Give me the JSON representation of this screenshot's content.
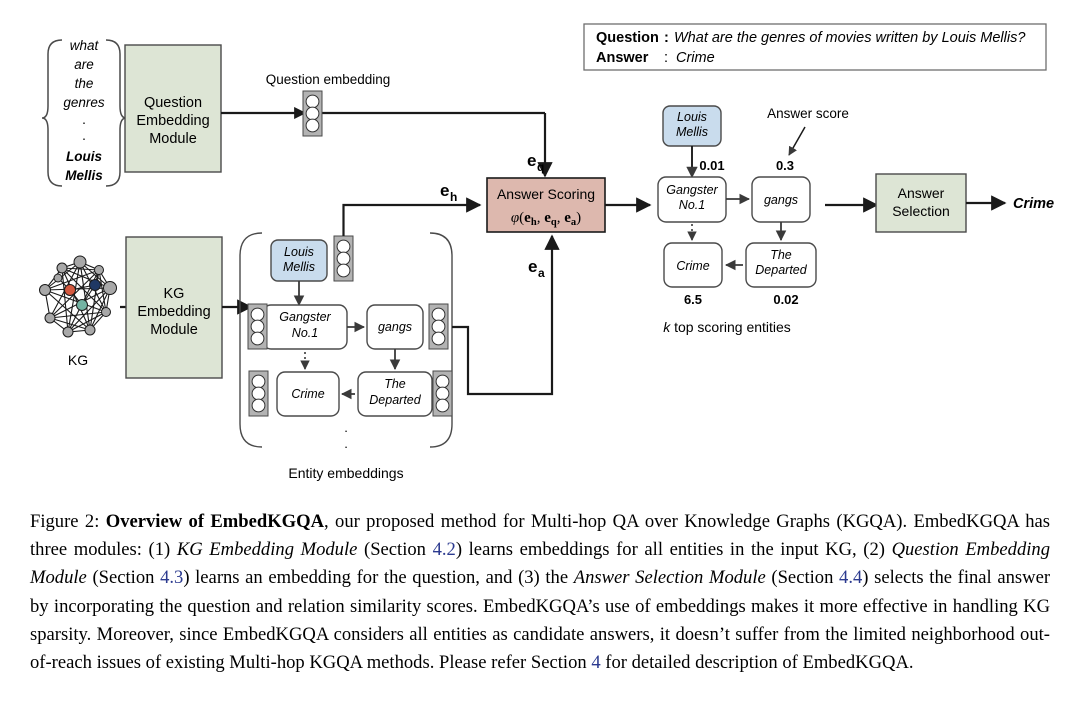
{
  "figure": {
    "qa_box": {
      "question_label": "Question",
      "question_sep": ":",
      "question_text": "What are the genres of movies written by Louis Mellis?",
      "answer_label": "Answer",
      "answer_sep": ":",
      "answer_text": "Crime"
    },
    "question_input": {
      "lines": [
        "what",
        "are",
        "the",
        "genres",
        ".",
        ".",
        "Louis",
        "Mellis"
      ],
      "bold_lines": [
        "Louis",
        "Mellis"
      ]
    },
    "modules": {
      "question_embedding_module": "Question\nEmbedding\nModule",
      "question_embedding_module_lines": [
        "Question",
        "Embedding",
        "Module"
      ],
      "kg_embedding_module_lines": [
        "KG",
        "Embedding",
        "Module"
      ],
      "answer_scoring_title": "Answer Scoring",
      "answer_scoring_formula": "φ(e_h, e_q, e_a)",
      "answer_selection_lines": [
        "Answer",
        "Selection"
      ]
    },
    "labels": {
      "question_embedding": "Question embedding",
      "kg": "KG",
      "entity_embeddings": "Entity embeddings",
      "answer_score": "Answer score",
      "k_top_scoring": "k top scoring entities",
      "e_h": "e_h",
      "e_q": "e_q",
      "e_a": "e_a",
      "final_answer": "Crime"
    },
    "kg_graph_nodes": {
      "highlight_red": "#d4593f",
      "highlight_teal": "#73b3a3",
      "highlight_navy": "#1f3864",
      "default_node": "#a8a8a8"
    },
    "entity_graph": {
      "head_entity": {
        "lines": [
          "Louis",
          "Mellis"
        ]
      },
      "entities": [
        {
          "id": "gangster",
          "lines": [
            "Gangster",
            "No.1"
          ]
        },
        {
          "id": "gangs",
          "lines": [
            "gangs"
          ]
        },
        {
          "id": "crime",
          "lines": [
            "Crime"
          ]
        },
        {
          "id": "departed",
          "lines": [
            "The",
            "Departed"
          ]
        }
      ],
      "ellipsis": [
        ".",
        "."
      ]
    },
    "scored_graph": {
      "head_entity": {
        "lines": [
          "Louis",
          "Mellis"
        ]
      },
      "entities": [
        {
          "id": "gangster",
          "lines": [
            "Gangster",
            "No.1"
          ],
          "score": "0.01"
        },
        {
          "id": "gangs",
          "lines": [
            "gangs"
          ],
          "score": "0.3"
        },
        {
          "id": "crime",
          "lines": [
            "Crime"
          ],
          "score": "6.5"
        },
        {
          "id": "departed",
          "lines": [
            "The",
            "Departed"
          ],
          "score": "0.02"
        }
      ]
    },
    "colors": {
      "module_green": "#dde5d5",
      "scoring_pink": "#ddb8ae",
      "entity_blue": "#c9dced",
      "score_red": "#9e2b0e",
      "embedding_gray": "#b3b3b3",
      "stroke": "#1a1a1a"
    }
  },
  "caption": {
    "prefix": "Figure 2:",
    "bold_title": "Overview of EmbedKGQA",
    "seg1": ", our proposed method for Multi-hop QA over Knowledge Graphs (KGQA). EmbedKGQA has three modules: (1) ",
    "italic1": "KG Embedding Module",
    "seg2": " (Section ",
    "ref1": "4.2",
    "seg3": ") learns embeddings for all entities in the input KG, (2) ",
    "italic2": "Question Embedding Module",
    "seg4": " (Section ",
    "ref2": "4.3",
    "seg5": ") learns an embedding for the question, and (3) the ",
    "italic3": "Answer Selection Module",
    "seg6": " (Section ",
    "ref3": "4.4",
    "seg7": ") selects the final answer by incorporating the question and relation similarity scores. EmbedKGQA’s use of embeddings makes it more effective in handling KG sparsity. Moreover, since EmbedKGQA considers all entities as candidate answers, it doesn’t suffer from the limited neighborhood out-of-reach issues of existing Multi-hop KGQA methods. Please refer Section ",
    "ref4": "4",
    "seg8": " for detailed description of EmbedKGQA."
  }
}
